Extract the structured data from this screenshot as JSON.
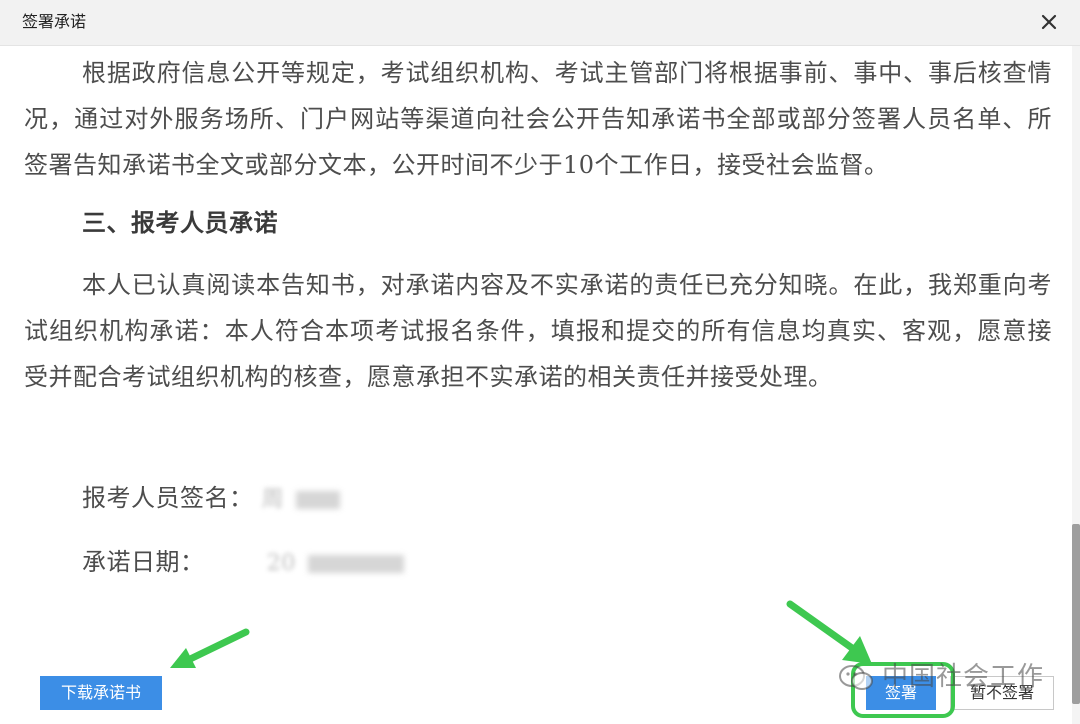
{
  "dialog": {
    "title": "签署承诺",
    "close_icon": "close-icon"
  },
  "content": {
    "paragraph_1": "根据政府信息公开等规定，考试组织机构、考试主管部门将根据事前、事中、事后核查情况，通过对外服务场所、门户网站等渠道向社会公开告知承诺书全部或部分签署人员名单、所签署告知承诺书全文或部分文本，公开时间不少于10个工作日，接受社会监督。",
    "section_heading": "三、报考人员承诺",
    "paragraph_2": "本人已认真阅读本告知书，对承诺内容及不实承诺的责任已充分知晓。在此，我郑重向考试组织机构承诺：本人符合本项考试报名条件，填报和提交的所有信息均真实、客观，愿意接受并配合考试组织机构的核查，愿意承担不实承诺的相关责任并接受处理。",
    "signature_label": "报考人员签名：",
    "signature_value": "周",
    "date_label": "承诺日期：",
    "date_value": "20"
  },
  "buttons": {
    "download": "下载承诺书",
    "sign": "签署",
    "not_sign": "暂不签署"
  },
  "watermark": {
    "text": "中国社会工作",
    "icon": "wechat-icon"
  },
  "colors": {
    "accent_blue": "#3c8ee6",
    "highlight_green": "#3ec850"
  }
}
